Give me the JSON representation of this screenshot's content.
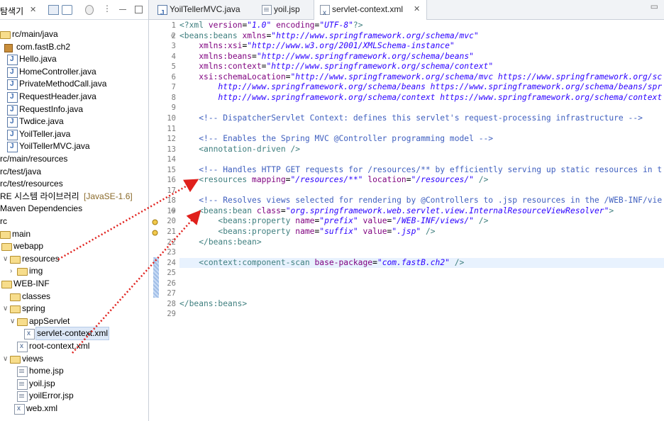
{
  "explorer": {
    "title": "탐색기",
    "close_glyph": "✕",
    "toolbar_icons": [
      "collapse-all-icon",
      "link-with-editor-icon",
      "filter-icon",
      "view-menu-icon",
      "minimize-icon",
      "maximize-icon"
    ],
    "tree": [
      {
        "label": "rc/main/java",
        "icon": "source-folder-icon",
        "twist": ""
      },
      {
        "label": "com.fastB.ch2",
        "icon": "package-icon",
        "twist": ""
      },
      {
        "label": "Hello.java",
        "icon": "java-file-icon",
        "twist": ""
      },
      {
        "label": "HomeController.java",
        "icon": "java-file-icon",
        "twist": ""
      },
      {
        "label": "PrivateMethodCall.java",
        "icon": "java-file-icon",
        "twist": ""
      },
      {
        "label": "RequestHeader.java",
        "icon": "java-file-icon",
        "twist": ""
      },
      {
        "label": "RequestInfo.java",
        "icon": "java-file-icon",
        "twist": ""
      },
      {
        "label": "Twdice.java",
        "icon": "java-file-icon",
        "twist": ""
      },
      {
        "label": "YoilTeller.java",
        "icon": "java-file-icon",
        "twist": ""
      },
      {
        "label": "YoilTellerMVC.java",
        "icon": "java-file-icon",
        "twist": ""
      },
      {
        "label": "rc/main/resources",
        "icon": "",
        "twist": ""
      },
      {
        "label": "rc/test/java",
        "icon": "",
        "twist": ""
      },
      {
        "label": "rc/test/resources",
        "icon": "",
        "twist": ""
      },
      {
        "label": "RE 시스템 라이브러리",
        "suffix": "[JavaSE-1.6]",
        "icon": "",
        "twist": ""
      },
      {
        "label": "Maven Dependencies",
        "icon": "",
        "twist": ""
      },
      {
        "label": "rc",
        "icon": "",
        "twist": ""
      },
      {
        "label": "main",
        "icon": "folder-icon",
        "twist": ""
      },
      {
        "label": "webapp",
        "icon": "folder-icon",
        "twist": "∨"
      },
      {
        "label": "resources",
        "icon": "folder-icon",
        "twist": "∨"
      },
      {
        "label": "img",
        "icon": "folder-icon",
        "twist": "›"
      },
      {
        "label": "WEB-INF",
        "icon": "folder-icon",
        "twist": "∨"
      },
      {
        "label": "classes",
        "icon": "folder-icon",
        "twist": ""
      },
      {
        "label": "spring",
        "icon": "folder-icon",
        "twist": "∨"
      },
      {
        "label": "appServlet",
        "icon": "folder-icon",
        "twist": "∨"
      },
      {
        "label": "servlet-context.xml",
        "icon": "xml-file-icon",
        "twist": "",
        "selected": true
      },
      {
        "label": "root-context.xml",
        "icon": "xml-file-icon",
        "twist": ""
      },
      {
        "label": "views",
        "icon": "folder-icon",
        "twist": "∨"
      },
      {
        "label": "home.jsp",
        "icon": "file-icon",
        "twist": ""
      },
      {
        "label": "yoil.jsp",
        "icon": "file-icon",
        "twist": ""
      },
      {
        "label": "yoilError.jsp",
        "icon": "file-icon",
        "twist": ""
      },
      {
        "label": "web.xml",
        "icon": "xml-file-icon",
        "twist": ""
      }
    ]
  },
  "editor": {
    "tabs": [
      {
        "label": "YoilTellerMVC.java",
        "icon": "java-file-icon",
        "active": false
      },
      {
        "label": "yoil.jsp",
        "icon": "file-icon",
        "active": false
      },
      {
        "label": "servlet-context.xml",
        "icon": "xml-file-icon",
        "active": true,
        "close": "✕"
      }
    ],
    "minimize_glyph": "▭",
    "lines": [
      {
        "n": "1",
        "html": "<span class='t'>&lt;?xml</span> <span class='a'>version</span>=<span class='s'>\"1.0\"</span> <span class='a'>encoding</span>=<span class='s'>\"UTF-8\"</span><span class='t'>?&gt;</span>"
      },
      {
        "n": "2",
        "fold": "⊖",
        "html": "<span class='t'>&lt;beans:beans</span> <span class='a'>xmlns</span>=<span class='s'>\"http://www.springframework.org/schema/mvc\"</span>"
      },
      {
        "n": "3",
        "html": "    <span class='a'>xmlns:xsi</span>=<span class='s'>\"http://www.w3.org/2001/XMLSchema-instance\"</span>"
      },
      {
        "n": "4",
        "html": "    <span class='a'>xmlns:beans</span>=<span class='s'>\"http://www.springframework.org/schema/beans\"</span>"
      },
      {
        "n": "5",
        "html": "    <span class='a'>xmlns:context</span>=<span class='s'>\"http://www.springframework.org/schema/context\"</span>"
      },
      {
        "n": "6",
        "html": "    <span class='a'>xsi:schemaLocation</span>=<span class='s'>\"http://www.springframework.org/schema/mvc https://www.springframework.org/sc</span>"
      },
      {
        "n": "7",
        "html": "<span class='s'>        http://www.springframework.org/schema/beans https://www.springframework.org/schema/beans/spr</span>"
      },
      {
        "n": "8",
        "html": "<span class='s'>        http://www.springframework.org/schema/context https://www.springframework.org/schema/context</span>"
      },
      {
        "n": "9",
        "html": ""
      },
      {
        "n": "10",
        "html": "    <span class='c'>&lt;!-- DispatcherServlet Context: defines this servlet's request-processing infrastructure --&gt;</span>"
      },
      {
        "n": "11",
        "html": ""
      },
      {
        "n": "12",
        "html": "    <span class='c'>&lt;!-- Enables the Spring MVC @Controller programming model --&gt;</span>"
      },
      {
        "n": "13",
        "html": "    <span class='t'>&lt;annotation-driven</span> <span class='t'>/&gt;</span>"
      },
      {
        "n": "14",
        "html": ""
      },
      {
        "n": "15",
        "html": "    <span class='c'>&lt;!-- Handles HTTP GET requests for /resources/** by efficiently serving up static resources in t</span>"
      },
      {
        "n": "16",
        "html": "    <span class='t'>&lt;resources</span> <span class='a'>mapping</span>=<span class='s'>\"/resources/**\"</span> <span class='a'>location</span>=<span class='s'>\"/resources/\"</span> <span class='t'>/&gt;</span>"
      },
      {
        "n": "17",
        "html": ""
      },
      {
        "n": "18",
        "html": "    <span class='c'>&lt;!-- Resolves views selected for rendering by @Controllers to .jsp resources in the /WEB-INF/vie</span>"
      },
      {
        "n": "19",
        "fold": "⊖",
        "html": "    <span class='t'>&lt;beans:bean</span> <span class='a'>class</span>=<span class='s'>\"org.springframework.web.servlet.view.InternalResourceViewResolver\"</span><span class='t'>&gt;</span>"
      },
      {
        "n": "20",
        "marker": true,
        "html": "        <span class='t'>&lt;beans:property</span> <span class='a'>name</span>=<span class='s'>\"prefix\"</span> <span class='a'>value</span>=<span class='s'>\"/WEB-INF/views/\"</span> <span class='t'>/&gt;</span>"
      },
      {
        "n": "21",
        "marker": true,
        "html": "        <span class='t'>&lt;beans:property</span> <span class='a'>name</span>=<span class='s'>\"suffix\"</span> <span class='a'>value</span>=<span class='s'>\".jsp\"</span> <span class='t'>/&gt;</span>"
      },
      {
        "n": "22",
        "html": "    <span class='t'>&lt;/beans:bean&gt;</span>"
      },
      {
        "n": "23",
        "html": ""
      },
      {
        "n": "24",
        "current": true,
        "html": "    <span class='t'>&lt;context:component-scan</span> <span class='a'>base-package</span>=<span class='s'>\"com.fastB.ch2\"</span> <span class='t'>/&gt;</span>"
      },
      {
        "n": "25",
        "html": ""
      },
      {
        "n": "26",
        "html": ""
      },
      {
        "n": "27",
        "html": ""
      },
      {
        "n": "28",
        "html": "<span class='t'>&lt;/beans:beans&gt;</span>"
      },
      {
        "n": "29",
        "html": ""
      }
    ]
  },
  "annotations": {
    "arrow_color": "#e0201c"
  }
}
